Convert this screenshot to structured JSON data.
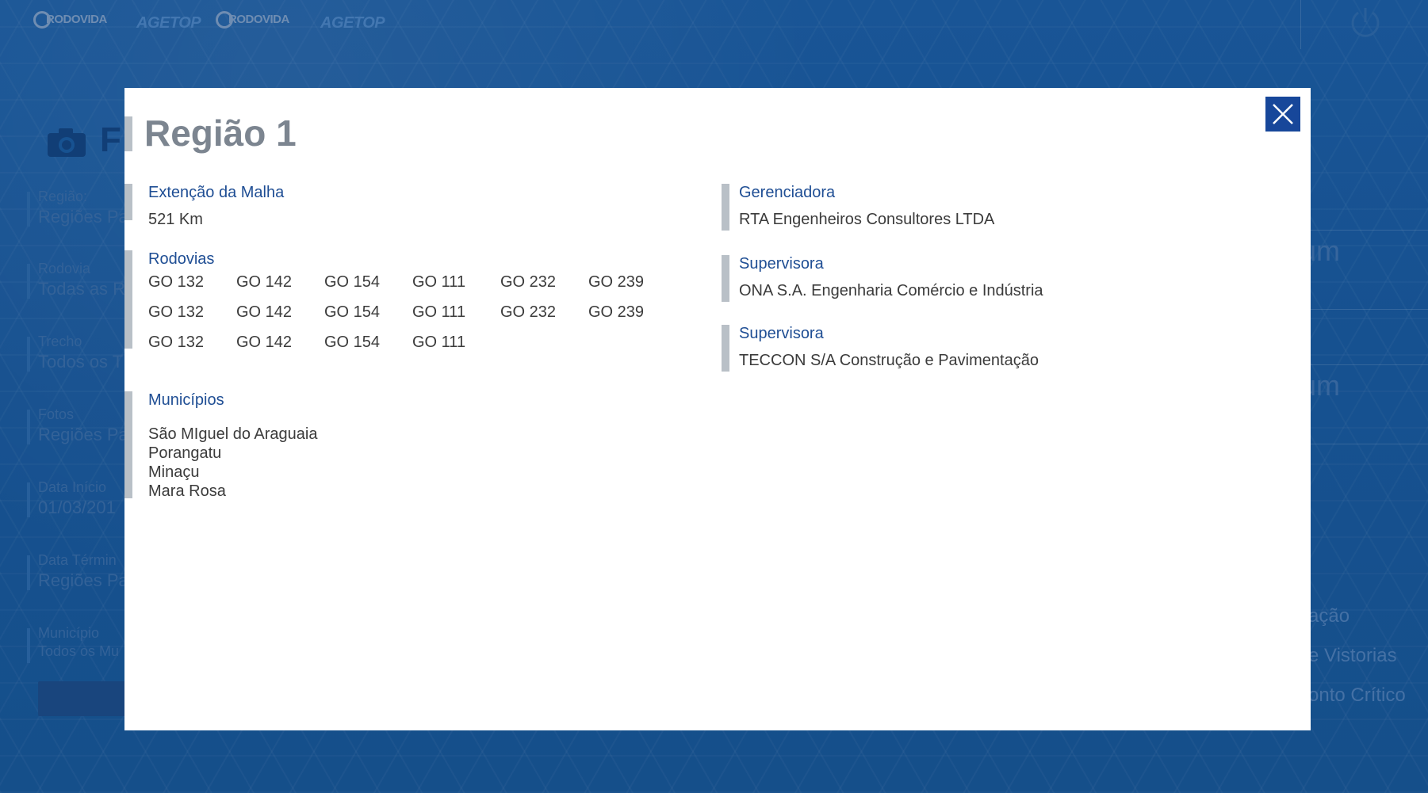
{
  "header": {
    "logos": [
      "RODOVIDA",
      "AGETOP",
      "RODOVIDA",
      "AGETOP"
    ]
  },
  "background": {
    "page_title": "F",
    "fields": [
      {
        "label": "Região:",
        "value": "Regiões Pa"
      },
      {
        "label": "Rodovia",
        "value": "Todas as R"
      },
      {
        "label": "Trecho",
        "value": "Todos os T"
      },
      {
        "label": "Fotos",
        "value": "Regiões Pa"
      },
      {
        "label": "Data Início",
        "value": "01/03/201"
      },
      {
        "label": "Data Términ",
        "value": "Regiões Pa"
      },
      {
        "label": "Município",
        "value": "Todos os Mu"
      }
    ],
    "right_texts": [
      "um",
      "um",
      "ação",
      "e Vistorias",
      "onto Crítico"
    ]
  },
  "modal": {
    "title": "Região 1",
    "extensao": {
      "label": "Extenção da Malha",
      "value": "521 Km"
    },
    "rodovias": {
      "label": "Rodovias",
      "items": [
        "GO 132",
        "GO 142",
        "GO 154",
        "GO 111",
        "GO 232",
        "GO 239",
        "GO 132",
        "GO 142",
        "GO 154",
        "GO 111",
        "GO 232",
        "GO 239",
        "GO 132",
        "GO 142",
        "GO 154",
        "GO 111"
      ]
    },
    "municipios": {
      "label": "Municípios",
      "items": [
        "São MIguel do Araguaia",
        "Porangatu",
        "Minaçu",
        "Mara Rosa"
      ]
    },
    "gerenciadora": {
      "label": "Gerenciadora",
      "value": "RTA Engenheiros Consultores LTDA"
    },
    "supervisora1": {
      "label": "Supervisora",
      "value": "ONA S.A. Engenharia Comércio e Indústria"
    },
    "supervisora2": {
      "label": "Supervisora",
      "value": "TECCON S/A Construção e Pavimentação"
    }
  },
  "colors": {
    "accent": "#1f4e94",
    "close_button": "#17479a",
    "section_bar": "#b9c0c7"
  }
}
